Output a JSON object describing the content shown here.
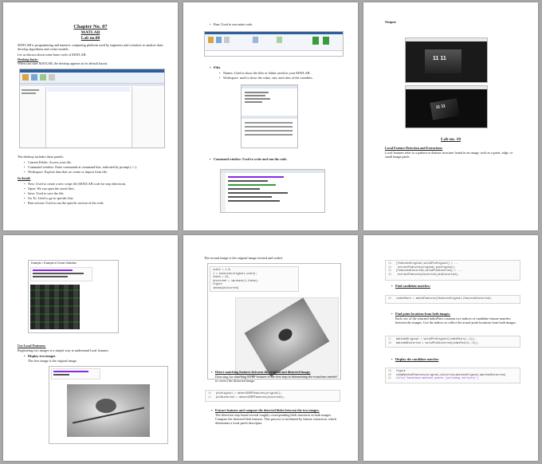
{
  "page1": {
    "chapter": "Chapter No. 07",
    "subject": "MATLAB",
    "lab": "Lab no.08",
    "intro": "MATLAB is programming and numeric computing platform used by engineers and scientists to analyze data, develop algorithms and create models.",
    "intro2": "Let us discuss about some basic tools of MATLAB.",
    "desktop_heading": "Desktop basic:",
    "desktop_text": "When you start MATLAB, the desktop appears in its default layout.",
    "panels_intro": "The desktop includes these panels:",
    "panels": [
      "Current Folder: Access your file.",
      "Command window: Enter commands at command line, indicated by prompt (>>).",
      "Workspace: Explore data that we create or import from file."
    ],
    "install_heading": "In detail:",
    "install_items": [
      "New: Used to create a new script file (MATLAB code for step detection).",
      "Open: We can open the saved files.",
      "Save: Used to save the file.",
      "Go To: Used to go to specific line.",
      "Run section: Used to run the specific section of the code."
    ]
  },
  "page2": {
    "run_item": "Run: Used to run entire code.",
    "files_heading": "Files",
    "files_items": [
      "Names: Used to show the files or folder saved in your MATLAB.",
      "Workspace: used to show the value, size, and class of the variables."
    ],
    "command_item": "Command window: Used to write and run the code."
  },
  "page3": {
    "output_label": "Output:",
    "clock_text": "11 11",
    "lab_heading": "Lab no. 10",
    "section_heading": "Local Feature Detection and Extraction:",
    "section_text": "Local features refer to a pattern or distinct structure found in an image, such as a point, edge, or small image patch."
  },
  "page4": {
    "window_title": "Example > Example of Corner Detection",
    "heading": "Use Local Features:",
    "text": "Registering two images is a simple way to understand local features.",
    "bullet": "Display two images",
    "bullet_text": "The first image is the original image."
  },
  "page5": {
    "intro": "The second image is the original image twisted and scaled.",
    "code_lines": [
      "scale = 1.3;",
      "J = imresize(original,scale);",
      "theta = 31;",
      "distorted = imrotate(J,theta);",
      "figure",
      "imshow(distorted)"
    ],
    "bullet1": "Detect matching features between the original and distorted image.",
    "bullet1_text": "Detecting the matching SURF features is the first step in determining the transform needed to correct the distorted image.",
    "code2_lines": [
      "ptsOriginal = detectSURFFeatures(original);",
      "ptsDistorted = detectSURFFeatures(distorted);"
    ],
    "bullet2": "Extract features and compare the detected blobs between the two images.",
    "bullet2_text": "The detection step found several roughly corresponding blob structures in both images. Compare the detected blob features. This process is facilitated by feature extraction, which determines a local patch descriptor."
  },
  "page6": {
    "code1_lines": [
      "[featuresOriginal,validPtsOriginal] = ...",
      "    extractFeatures(original,ptsOriginal);",
      "[featuresDistorted,validPtsDistorted] = ...",
      "    extractFeatures(distorted,ptsDistorted);"
    ],
    "code1_nums": [
      "13",
      "14",
      "15",
      "16"
    ],
    "bullet1": "Find candidate matches:",
    "code2_lines": [
      "indexPairs = matchFeatures(featuresOriginal,featuresDistorted);"
    ],
    "code2_nums": [
      "18"
    ],
    "bullet2": "Find point locations from both images.",
    "bullet2_text": "Each row of the returned indexPairs contains two indices of candidate feature matches between the images. Use the indices to collect the actual point locations from both images.",
    "code3_lines": [
      "matchedOriginal = validPtsOriginal(indexPairs(:,1));",
      "matchedDistorted = validPtsDistorted(indexPairs(:,2));"
    ],
    "code3_nums": [
      "17",
      "18"
    ],
    "bullet3": "Display the candidate matches",
    "code4_lines": [
      "figure",
      "showMatchedFeatures(original,distorted,matchedOriginal,matchedDistorted)",
      "title('Candidate matched points (including outliers)')"
    ],
    "code4_nums": [
      "19",
      "20",
      "21"
    ]
  },
  "colors": {
    "background": "#a9a9a9",
    "page": "#ffffff",
    "matlab_blue": "#2f5f9e",
    "code_purple": "#8a2be2"
  }
}
